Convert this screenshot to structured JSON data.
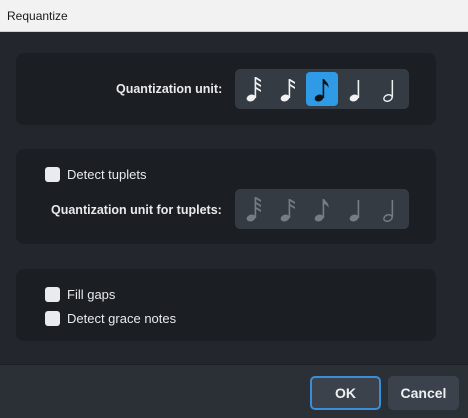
{
  "window": {
    "title": "Requantize"
  },
  "quantization": {
    "label": "Quantization unit:",
    "options": [
      "32nd-note-icon",
      "16th-note-icon",
      "eighth-note-icon",
      "quarter-note-icon",
      "half-note-icon"
    ],
    "selected_index": 2
  },
  "tuplets": {
    "detect_label": "Detect tuplets",
    "detect_checked": false,
    "unit_label": "Quantization unit for tuplets:",
    "unit_enabled": false
  },
  "options": {
    "fill_gaps_label": "Fill gaps",
    "fill_gaps_checked": false,
    "grace_notes_label": "Detect grace notes",
    "grace_notes_checked": false
  },
  "buttons": {
    "ok": "OK",
    "cancel": "Cancel"
  },
  "colors": {
    "accent": "#2f9be6",
    "panel": "#1b1e22",
    "background": "#23272d"
  }
}
